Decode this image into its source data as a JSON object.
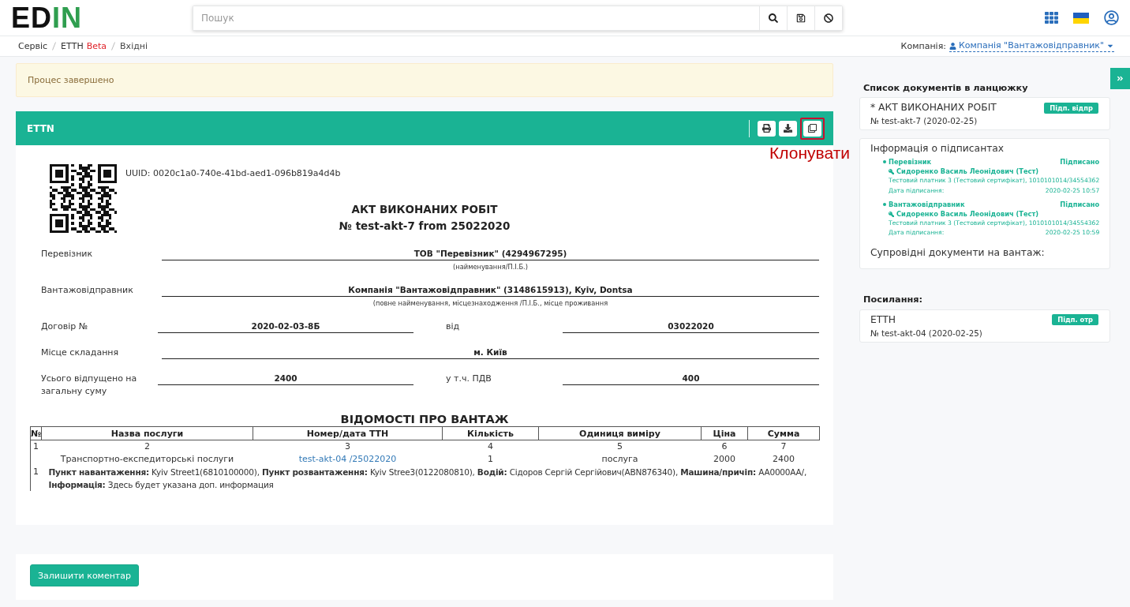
{
  "header": {
    "logo": [
      {
        "text": "ED",
        "color": "#111111"
      },
      {
        "text": "IN",
        "color": "#2f9e4f"
      }
    ],
    "search": {
      "placeholder": "Пошук"
    }
  },
  "breadcrumb": [
    {
      "label": "Сервіс"
    },
    {
      "label": "ЕТТН",
      "tag": "Beta"
    },
    {
      "label": "Вхідні"
    }
  ],
  "company": {
    "label": "Компанія:",
    "value": "Компанія \"Вантажовідправник\""
  },
  "alert": "Процес завершено",
  "document": {
    "title": "ETTN",
    "actions": [
      {
        "kind": "print",
        "highlighted": false
      },
      {
        "kind": "download",
        "highlighted": false
      },
      {
        "kind": "clone",
        "highlighted": true,
        "callout": "Клонувати"
      }
    ],
    "uuid": "UUID: 0020c1a0-740e-41bd-aed1-096b819a4d4b",
    "heading": "АКТ ВИКОНАНИХ РОБІТ",
    "number": "№ test-akt-7 from 25022020",
    "fields": [
      {
        "kind": "wide",
        "label": "Перевізник",
        "value": "ТОВ \"Перевізник\" (4294967295)",
        "caption": "(найменування/П.І.Б.)"
      },
      {
        "kind": "wide",
        "label": "Вантажовідправник",
        "value": "Компанія \"Вантажовідправник\" (3148615913), Kyiv, Dontsa",
        "caption": "(повне найменування, місцезнаходження /П.І.Б., місце проживання"
      },
      {
        "kind": "pair",
        "label": "Договір №",
        "value": "2020-02-03-8Б",
        "second_label": "від",
        "second_value": "03022020"
      },
      {
        "kind": "wide",
        "label": "Місце складання",
        "value": "м. Київ"
      },
      {
        "kind": "pair",
        "label": "Усього відпущено на загальну суму",
        "value": "2400",
        "second_label": "у т.ч. ПДВ",
        "second_value": "400"
      }
    ],
    "cargo": {
      "title": "ВІДОМОСТІ ПРО ВАНТАЖ",
      "columns": [
        "№",
        "Назва послуги",
        "Номер/дата ТТН",
        "Кількість",
        "Одиниця виміру",
        "Ціна",
        "Сумма"
      ],
      "column_numbers": [
        "1",
        "2",
        "3",
        "4",
        "5",
        "6",
        "7"
      ],
      "rows": [
        {
          "service": "Транспортно-експедиторські послуги",
          "ttn": "test-akt-04 /25022020",
          "quantity": "1",
          "unit": "послуга",
          "price": "2000",
          "sum": "2400"
        }
      ],
      "details": [
        {
          "number": "1",
          "text": "**Пункт навантаження:** Kyiv Street1(6810100000), **Пункт розвантаження:** Kyiv Stree3(0122080810), **Водій:** Сідоров Сергій Сергійович(ABN876340), **Машина/причіп:** AA0000AA/, **Інформація:** Здесь будет указана доп. информация"
        }
      ]
    }
  },
  "comment_button": "Залишити коментар",
  "sidebar": {
    "chain_title": "Список документів в ланцюжку",
    "chain_documents": [
      {
        "title": "* АКТ ВИКОНАНИХ РОБІТ",
        "status": "Підп. відпр",
        "number": "№ test-akt-7 (2020-02-25)"
      }
    ],
    "signers_title": "Інформація о підписантах",
    "signers": [
      {
        "role": "Перевізник",
        "status": "Підписано",
        "name": "Сидоренко Василь Леонідович (Тест)",
        "certificate": "Тестовий платник 3 (Тестовий сертифікат), 1010101014/34554362",
        "date_label": "Дата підписання:",
        "date": "2020-02-25 10:57"
      },
      {
        "role": "Вантажовідправник",
        "status": "Підписано",
        "name": "Сидоренко Василь Леонідович (Тест)",
        "certificate": "Тестовий платник 3 (Тестовий сертифікат), 1010101014/34554362",
        "date_label": "Дата підписання:",
        "date": "2020-02-25 10:59"
      }
    ],
    "accompanying_title": "Супровідні документи на вантаж:",
    "links_title": "Посилання:",
    "links": [
      {
        "title": "ЕТТН",
        "status": "Підп. отр",
        "number": "№ test-akt-04 (2020-02-25)"
      }
    ]
  }
}
